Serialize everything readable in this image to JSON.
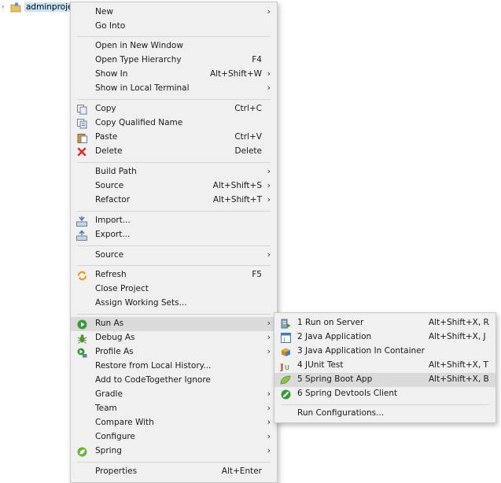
{
  "tree": {
    "project_label": "adminproject"
  },
  "main_menu": {
    "items": {
      "new": {
        "label": "New"
      },
      "go_into": {
        "label": "Go Into"
      },
      "open_new_window": {
        "label": "Open in New Window"
      },
      "open_type_hierarchy": {
        "label": "Open Type Hierarchy",
        "shortcut": "F4"
      },
      "show_in": {
        "label": "Show In",
        "shortcut": "Alt+Shift+W"
      },
      "show_in_local_terminal": {
        "label": "Show in Local Terminal"
      },
      "copy": {
        "label": "Copy",
        "shortcut": "Ctrl+C"
      },
      "copy_qualified_name": {
        "label": "Copy Qualified Name"
      },
      "paste": {
        "label": "Paste",
        "shortcut": "Ctrl+V"
      },
      "delete": {
        "label": "Delete",
        "shortcut": "Delete"
      },
      "build_path": {
        "label": "Build Path"
      },
      "source": {
        "label": "Source",
        "shortcut": "Alt+Shift+S"
      },
      "refactor": {
        "label": "Refactor",
        "shortcut": "Alt+Shift+T"
      },
      "import": {
        "label": "Import..."
      },
      "export": {
        "label": "Export..."
      },
      "source2": {
        "label": "Source"
      },
      "refresh": {
        "label": "Refresh",
        "shortcut": "F5"
      },
      "close_project": {
        "label": "Close Project"
      },
      "assign_working_sets": {
        "label": "Assign Working Sets..."
      },
      "run_as": {
        "label": "Run As"
      },
      "debug_as": {
        "label": "Debug As"
      },
      "profile_as": {
        "label": "Profile As"
      },
      "restore_local_history": {
        "label": "Restore from Local History..."
      },
      "codetogether_ignore": {
        "label": "Add to CodeTogether Ignore"
      },
      "gradle": {
        "label": "Gradle"
      },
      "team": {
        "label": "Team"
      },
      "compare_with": {
        "label": "Compare With"
      },
      "configure": {
        "label": "Configure"
      },
      "spring": {
        "label": "Spring"
      },
      "properties": {
        "label": "Properties",
        "shortcut": "Alt+Enter"
      }
    }
  },
  "run_as_submenu": {
    "items": {
      "run_on_server": {
        "label": "1 Run on Server",
        "shortcut": "Alt+Shift+X, R"
      },
      "java_application": {
        "label": "2 Java Application",
        "shortcut": "Alt+Shift+X, J"
      },
      "java_app_container": {
        "label": "3 Java Application In Container"
      },
      "junit_test": {
        "label": "4 JUnit Test",
        "shortcut": "Alt+Shift+X, T"
      },
      "spring_boot_app": {
        "label": "5 Spring Boot App",
        "shortcut": "Alt+Shift+X, B"
      },
      "spring_devtools_client": {
        "label": "6 Spring Devtools Client"
      },
      "run_configurations": {
        "label": "Run Configurations..."
      }
    }
  },
  "colors": {
    "menu_bg": "#f0f0f0",
    "highlight": "#dadada",
    "selection": "#cce4f7",
    "delete_red": "#d9302b",
    "run_green": "#3a9a3a",
    "spring_green": "#6db33f"
  }
}
